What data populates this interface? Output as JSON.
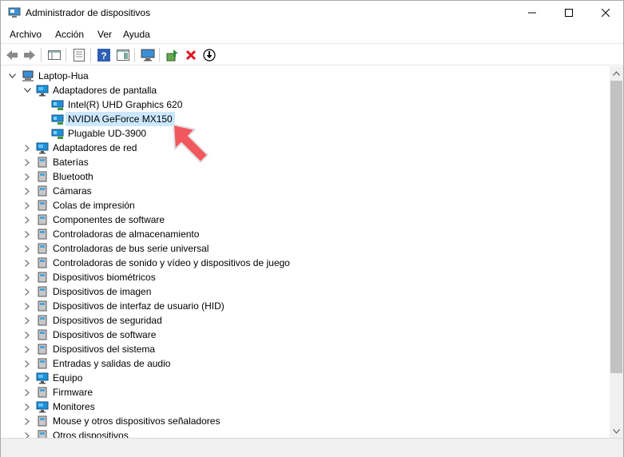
{
  "window": {
    "title": "Administrador de dispositivos",
    "minimize_icon": "minimize-icon",
    "maximize_icon": "maximize-icon",
    "close_icon": "close-icon"
  },
  "menu": {
    "items": [
      {
        "label": "Archivo"
      },
      {
        "label": "Acción"
      },
      {
        "label": "Ver"
      },
      {
        "label": "Ayuda"
      }
    ]
  },
  "toolbar": {
    "buttons": [
      {
        "name": "back",
        "icon": "arrow-left-icon"
      },
      {
        "name": "forward",
        "icon": "arrow-right-icon"
      },
      {
        "name": "show-hide-console-tree",
        "icon": "console-tree-icon"
      },
      {
        "name": "properties",
        "icon": "properties-icon"
      },
      {
        "name": "help",
        "icon": "help-icon"
      },
      {
        "name": "action-pane",
        "icon": "action-pane-icon"
      },
      {
        "name": "scan-hardware",
        "icon": "monitor-scan-icon"
      },
      {
        "name": "update-driver",
        "icon": "update-driver-icon"
      },
      {
        "name": "uninstall-device",
        "icon": "red-x-icon"
      },
      {
        "name": "disable-device",
        "icon": "down-arrow-circle-icon"
      }
    ]
  },
  "tree": {
    "root": {
      "label": "Laptop-Hua",
      "expanded": true
    },
    "items": [
      {
        "label": "Adaptadores de pantalla",
        "level": 1,
        "expanded": true
      },
      {
        "label": "Intel(R) UHD Graphics 620",
        "level": 2
      },
      {
        "label": "NVIDIA GeForce MX150",
        "level": 2,
        "selected": true
      },
      {
        "label": "Plugable UD-3900",
        "level": 2
      },
      {
        "label": "Adaptadores de red",
        "level": 1
      },
      {
        "label": "Baterías",
        "level": 1
      },
      {
        "label": "Bluetooth",
        "level": 1
      },
      {
        "label": "Cámaras",
        "level": 1
      },
      {
        "label": "Colas de impresión",
        "level": 1
      },
      {
        "label": "Componentes de software",
        "level": 1
      },
      {
        "label": "Controladoras de almacenamiento",
        "level": 1
      },
      {
        "label": "Controladoras de bus serie universal",
        "level": 1
      },
      {
        "label": "Controladoras de sonido y vídeo y dispositivos de juego",
        "level": 1
      },
      {
        "label": "Dispositivos biométricos",
        "level": 1
      },
      {
        "label": "Dispositivos de imagen",
        "level": 1
      },
      {
        "label": "Dispositivos de interfaz de usuario (HID)",
        "level": 1
      },
      {
        "label": "Dispositivos de seguridad",
        "level": 1
      },
      {
        "label": "Dispositivos de software",
        "level": 1
      },
      {
        "label": "Dispositivos del sistema",
        "level": 1
      },
      {
        "label": "Entradas y salidas de audio",
        "level": 1
      },
      {
        "label": "Equipo",
        "level": 1
      },
      {
        "label": "Firmware",
        "level": 1
      },
      {
        "label": "Monitores",
        "level": 1
      },
      {
        "label": "Mouse y otros dispositivos señaladores",
        "level": 1
      },
      {
        "label": "Otros dispositivos",
        "level": 1
      }
    ]
  },
  "colors": {
    "selection": "#cce8ff",
    "pointer_arrow": "#f2575f",
    "monitor_blue": "#1e90d8"
  }
}
